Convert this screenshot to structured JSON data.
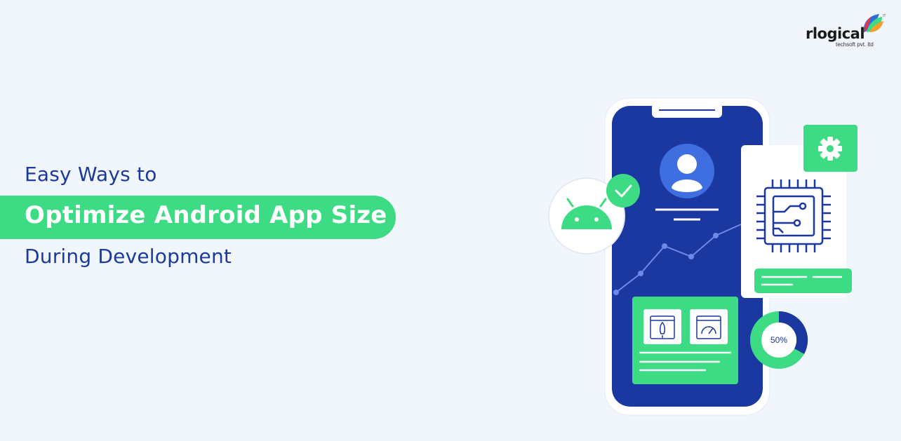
{
  "headline": {
    "line1": "Easy Ways to",
    "line2": "Optimize Android App Size",
    "line3": "During Development"
  },
  "logo": {
    "name": "rlogical",
    "tagline": "techsoft pvt. ltd"
  },
  "illustration": {
    "donut_label": "50%"
  },
  "colors": {
    "background": "#f1f6fd",
    "accent_green": "#3ddb84",
    "navy": "#1c3a9c",
    "phone_screen": "#1b37a0"
  },
  "icons": [
    "android-icon",
    "check-icon",
    "user-avatar-icon",
    "gear-icon",
    "chip-icon",
    "rocket-icon",
    "speedometer-icon"
  ]
}
